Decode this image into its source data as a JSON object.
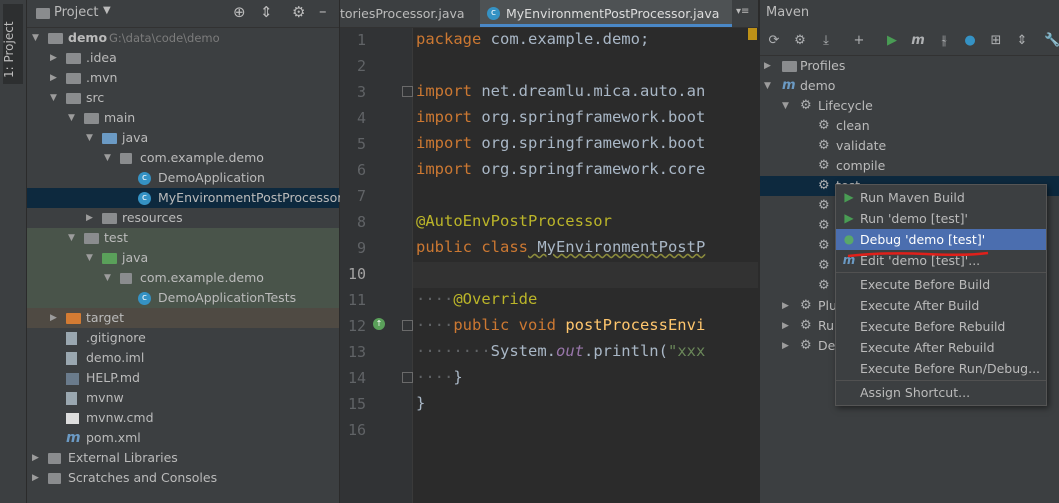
{
  "stripe": {
    "label": "1: Project"
  },
  "project": {
    "title": "Project",
    "tree": [
      {
        "label": "demo",
        "detail": "G:\\data\\code\\demo",
        "indent": 0,
        "arrow": "down",
        "icon": "folder"
      },
      {
        "label": ".idea",
        "indent": 1,
        "arrow": "right",
        "icon": "folder"
      },
      {
        "label": ".mvn",
        "indent": 1,
        "arrow": "right",
        "icon": "folder"
      },
      {
        "label": "src",
        "indent": 1,
        "arrow": "down",
        "icon": "folder"
      },
      {
        "label": "main",
        "indent": 2,
        "arrow": "down",
        "icon": "folder"
      },
      {
        "label": "java",
        "indent": 3,
        "arrow": "down",
        "icon": "folder-blue"
      },
      {
        "label": "com.example.demo",
        "indent": 4,
        "arrow": "down",
        "icon": "package"
      },
      {
        "label": "DemoApplication",
        "indent": 5,
        "arrow": "",
        "icon": "class"
      },
      {
        "label": "MyEnvironmentPostProcessor",
        "indent": 5,
        "arrow": "",
        "icon": "class"
      },
      {
        "label": "resources",
        "indent": 3,
        "arrow": "right",
        "icon": "folder"
      },
      {
        "label": "test",
        "indent": 2,
        "arrow": "down",
        "icon": "folder"
      },
      {
        "label": "java",
        "indent": 3,
        "arrow": "down",
        "icon": "folder-green"
      },
      {
        "label": "com.example.demo",
        "indent": 4,
        "arrow": "down",
        "icon": "package"
      },
      {
        "label": "DemoApplicationTests",
        "indent": 5,
        "arrow": "",
        "icon": "class"
      },
      {
        "label": "target",
        "indent": 1,
        "arrow": "right",
        "icon": "folder-orange"
      },
      {
        "label": ".gitignore",
        "indent": 1,
        "arrow": "",
        "icon": "file"
      },
      {
        "label": "demo.iml",
        "indent": 1,
        "arrow": "",
        "icon": "file"
      },
      {
        "label": "HELP.md",
        "indent": 1,
        "arrow": "",
        "icon": "md"
      },
      {
        "label": "mvnw",
        "indent": 1,
        "arrow": "",
        "icon": "file"
      },
      {
        "label": "mvnw.cmd",
        "indent": 1,
        "arrow": "",
        "icon": "cmd"
      },
      {
        "label": "pom.xml",
        "indent": 1,
        "arrow": "",
        "icon": "maven"
      },
      {
        "label": "External Libraries",
        "indent": 0,
        "arrow": "right",
        "icon": "library"
      },
      {
        "label": "Scratches and Consoles",
        "indent": 0,
        "arrow": "right",
        "icon": "scratch"
      }
    ]
  },
  "editor": {
    "tabs": [
      {
        "label": "toriesProcessor.java",
        "active": false
      },
      {
        "label": "MyEnvironmentPostProcessor.java",
        "active": true
      }
    ],
    "tab_overflow": "≡",
    "lines": [
      "1",
      "2",
      "3",
      "4",
      "5",
      "6",
      "7",
      "8",
      "9",
      "10",
      "11",
      "12",
      "13",
      "14",
      "15",
      "16"
    ],
    "code": {
      "l1_kw": "package",
      "l1_rest": " com.example.demo;",
      "l3_kw": "import",
      "l3_rest": " net.dreamlu.mica.auto.an",
      "l4_kw": "import",
      "l4_rest": " org.springframework.boot",
      "l5_kw": "import",
      "l5_rest": " org.springframework.boot",
      "l6_kw": "import",
      "l6_rest": " org.springframework.core",
      "l8_ann": "@AutoEnvPostProcessor",
      "l9_kw": "public class",
      "l9_rest": " MyEnvironmentPostP",
      "l11_dots": "····",
      "l11_ann": "@Override",
      "l12_dots": "····",
      "l12_kw": "public void",
      "l12_fn": " postProcessEnvi",
      "l13_dots": "········",
      "l13_a": "System.",
      "l13_it": "out",
      "l13_b": ".println(",
      "l13_str": "\"xxx",
      "l14_dots": "····",
      "l14_rest": "}",
      "l15_rest": "}"
    }
  },
  "maven": {
    "title": "Maven",
    "tree": [
      {
        "label": "Profiles",
        "indent": 0,
        "arrow": "right"
      },
      {
        "label": "demo",
        "indent": 0,
        "arrow": "down"
      },
      {
        "label": "Lifecycle",
        "indent": 1,
        "arrow": "down"
      },
      {
        "label": "clean",
        "indent": 2,
        "arrow": ""
      },
      {
        "label": "validate",
        "indent": 2,
        "arrow": ""
      },
      {
        "label": "compile",
        "indent": 2,
        "arrow": ""
      },
      {
        "label": "test",
        "indent": 2,
        "arrow": ""
      },
      {
        "label": "",
        "indent": 2,
        "arrow": ""
      },
      {
        "label": "",
        "indent": 2,
        "arrow": ""
      },
      {
        "label": "",
        "indent": 2,
        "arrow": ""
      },
      {
        "label": "",
        "indent": 2,
        "arrow": ""
      },
      {
        "label": "",
        "indent": 2,
        "arrow": ""
      },
      {
        "label": "Plug",
        "indent": 1,
        "arrow": "right"
      },
      {
        "label": "Run",
        "indent": 1,
        "arrow": "right"
      },
      {
        "label": "Dep",
        "indent": 1,
        "arrow": "right"
      }
    ]
  },
  "menu": {
    "items": [
      {
        "label": "Run Maven Build",
        "icon": "run"
      },
      {
        "label": "Run 'demo [test]'",
        "icon": "run"
      },
      {
        "label": "Debug 'demo [test]'",
        "icon": "debug",
        "highlighted": true
      },
      {
        "label": "Edit 'demo [test]'...",
        "icon": "maven"
      },
      {
        "label": "Execute Before Build",
        "icon": ""
      },
      {
        "label": "Execute After Build",
        "icon": ""
      },
      {
        "label": "Execute Before Rebuild",
        "icon": ""
      },
      {
        "label": "Execute After Rebuild",
        "icon": ""
      },
      {
        "label": "Execute Before Run/Debug...",
        "icon": ""
      },
      {
        "label": "Assign Shortcut...",
        "icon": ""
      }
    ]
  },
  "colors": {
    "accent": "#4b6eaf",
    "selection": "#0d293e",
    "annotation_underline": "#e0201a"
  }
}
